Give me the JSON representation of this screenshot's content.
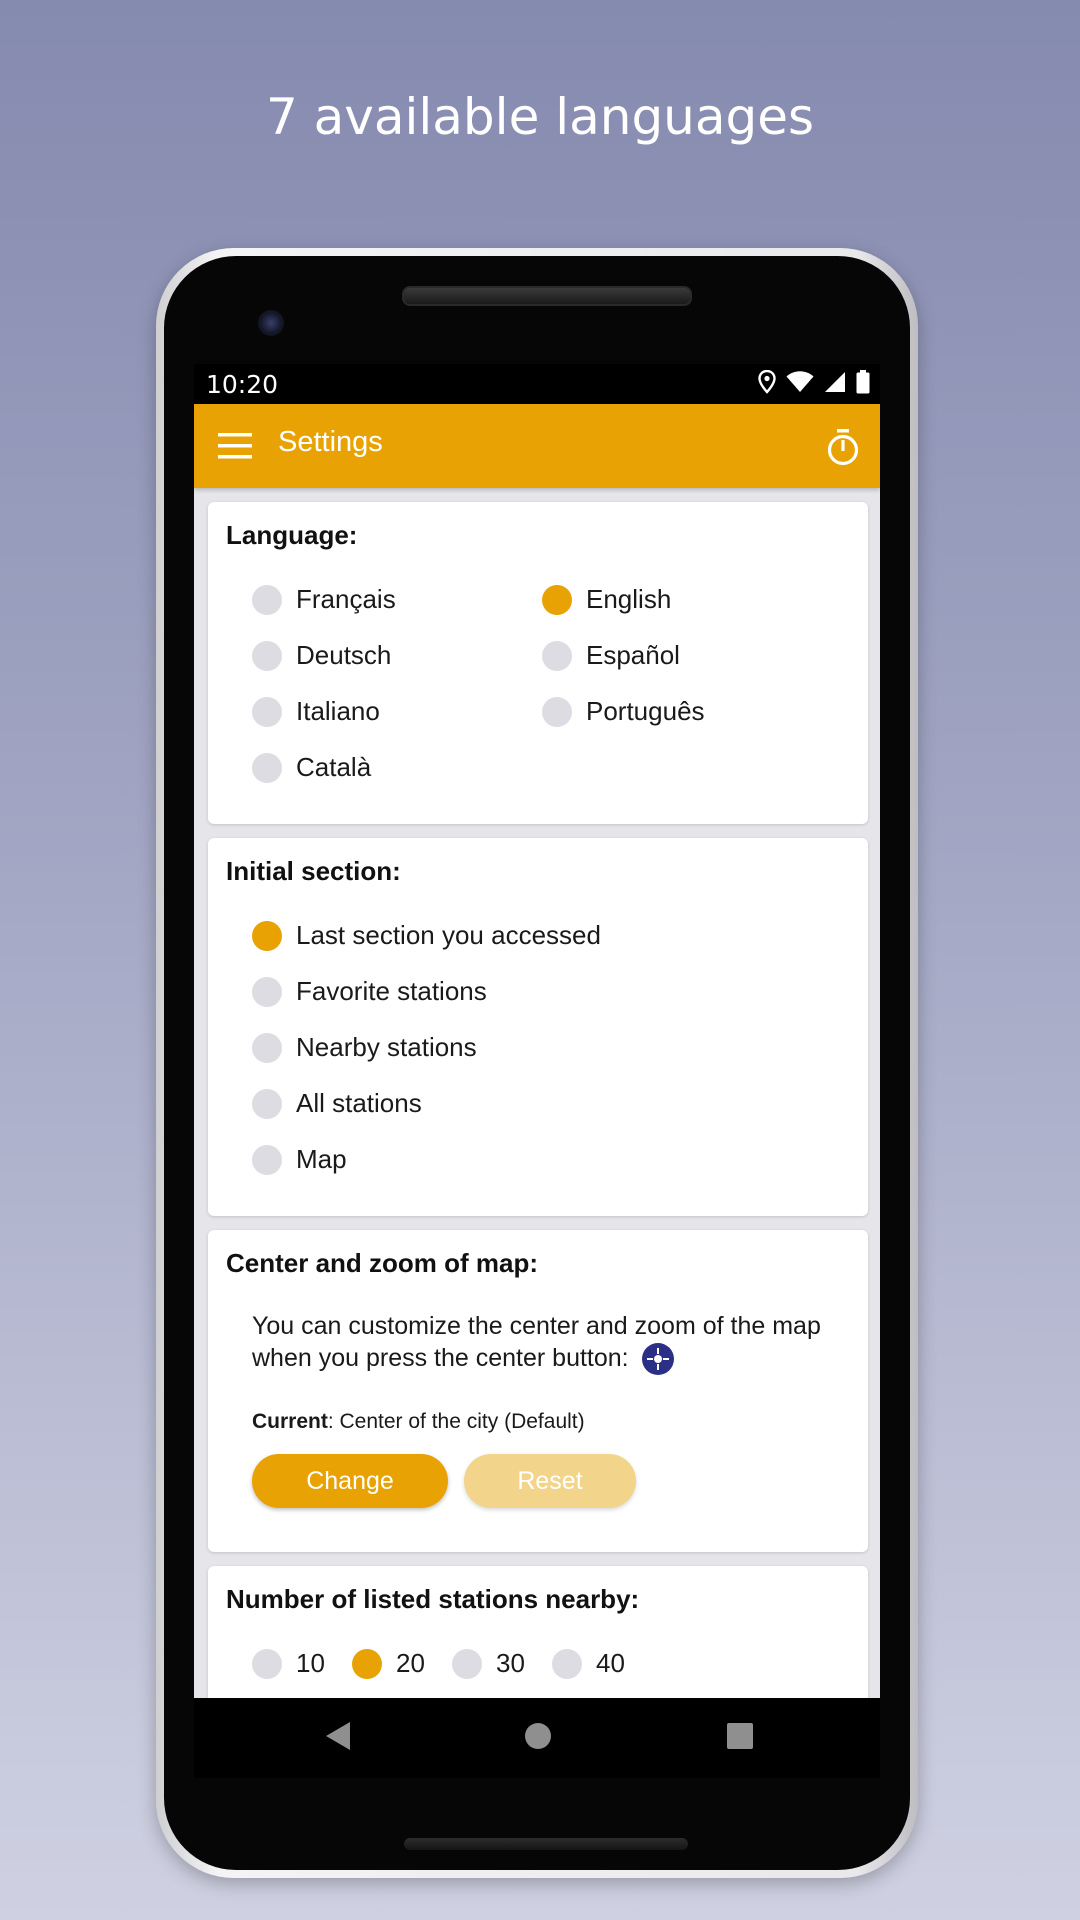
{
  "promo": {
    "title": "7 available languages"
  },
  "status_bar": {
    "time": "10:20"
  },
  "app_bar": {
    "title": "Settings"
  },
  "language": {
    "title": "Language:",
    "options": [
      {
        "label": "Français",
        "selected": false
      },
      {
        "label": "English",
        "selected": true
      },
      {
        "label": "Deutsch",
        "selected": false
      },
      {
        "label": "Español",
        "selected": false
      },
      {
        "label": "Italiano",
        "selected": false
      },
      {
        "label": "Português",
        "selected": false
      },
      {
        "label": "Català",
        "selected": false
      }
    ]
  },
  "initial_section": {
    "title": "Initial section:",
    "options": [
      {
        "label": "Last section you accessed",
        "selected": true
      },
      {
        "label": "Favorite stations",
        "selected": false
      },
      {
        "label": "Nearby stations",
        "selected": false
      },
      {
        "label": "All stations",
        "selected": false
      },
      {
        "label": "Map",
        "selected": false
      }
    ]
  },
  "map_center": {
    "title": "Center and zoom of map:",
    "description": "You can customize the center and zoom of the map when you press the center button:",
    "current_label": "Current",
    "current_value": ": Center of the city (Default)",
    "change_label": "Change",
    "reset_label": "Reset"
  },
  "nearby": {
    "title": "Number of listed stations nearby:",
    "options": [
      {
        "label": "10",
        "selected": false
      },
      {
        "label": "20",
        "selected": true
      },
      {
        "label": "30",
        "selected": false
      },
      {
        "label": "40",
        "selected": false
      }
    ]
  },
  "colors": {
    "accent": "#e8a203",
    "accent_light": "#f3d48b",
    "radio_off": "#dcdce2",
    "center_icon": "#2b2f86"
  }
}
